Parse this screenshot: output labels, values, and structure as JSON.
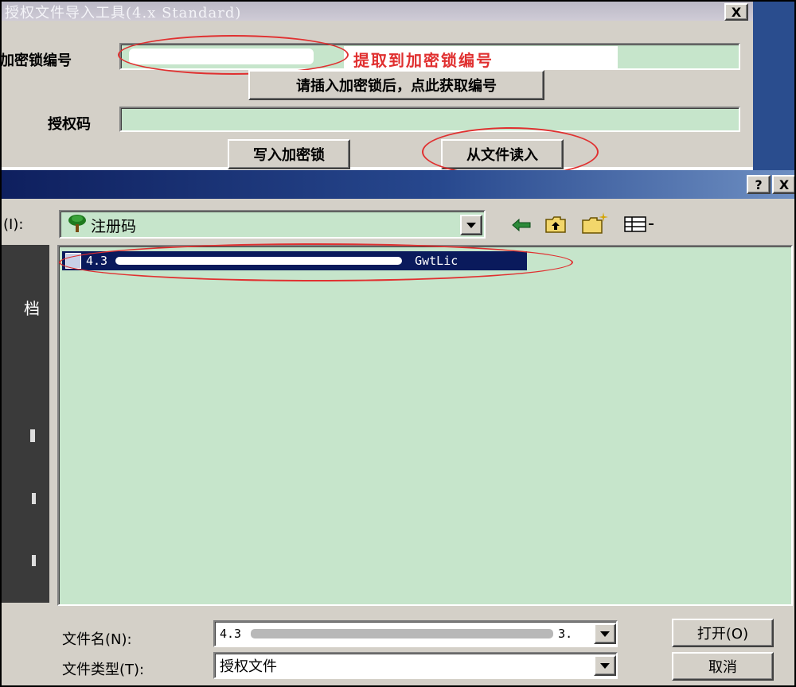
{
  "top_dialog": {
    "title": "授权文件导入工具(4.x Standard)",
    "close_glyph": "X",
    "dongle_label": "加密锁编号",
    "dongle_annotation": "提取到加密锁编号",
    "get_number_button": "请插入加密锁后，点此获取编号",
    "auth_code_label": "授权码",
    "auth_code_value": "",
    "write_button": "写入加密锁",
    "read_file_button": "从文件读入"
  },
  "open_dialog": {
    "help_glyph": "?",
    "close_glyph": "X",
    "lookin_label": "(I):",
    "lookin_value": "注册码",
    "sidebar_fragment": "档",
    "file_item": {
      "prefix": "4.3",
      "suffix": "GwtLic"
    },
    "filename_label": "文件名(N):",
    "filename_prefix": "4.3",
    "filename_suffix": "3.",
    "filetype_label": "文件类型(T):",
    "filetype_value": "授权文件",
    "open_button": "打开(O)",
    "cancel_button": "取消"
  },
  "colors": {
    "panel": "#d4d0c8",
    "field_green": "#c6e5cb",
    "titlebar_blue": "#10246a",
    "annotation_red": "#e03030",
    "selection_navy": "#0a1a5c"
  },
  "icons": [
    "tree-folder-icon",
    "dropdown-arrow-icon",
    "back-arrow-icon",
    "up-folder-icon",
    "new-folder-icon",
    "view-menu-icon",
    "file-icon"
  ]
}
